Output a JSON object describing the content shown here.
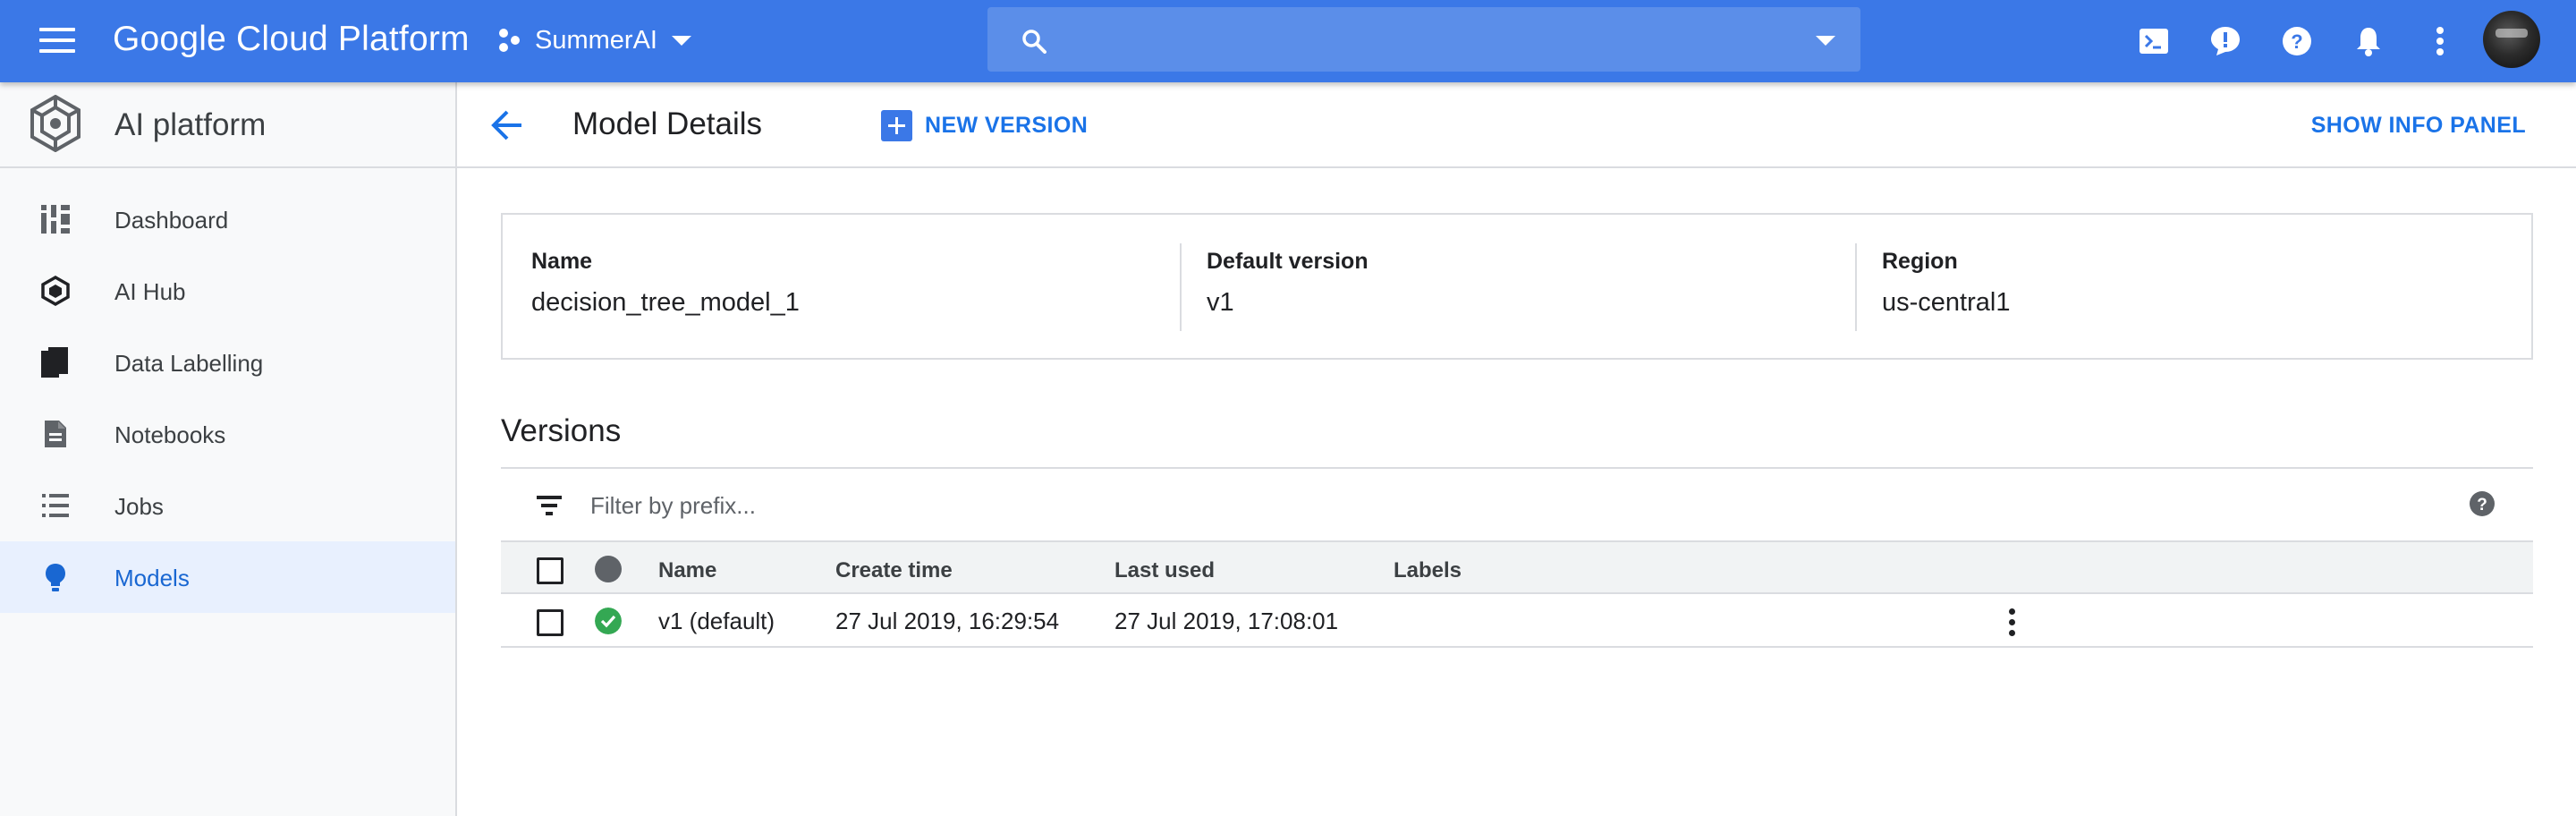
{
  "topbar": {
    "brand": "Google Cloud Platform",
    "project": "SummerAI",
    "search_placeholder": "",
    "bg_color": "#3b78e7",
    "icons": [
      "cloud-shell-icon",
      "feedback-icon",
      "help-icon",
      "notifications-icon",
      "more-vert-icon"
    ]
  },
  "sidebar": {
    "title": "AI platform",
    "items": [
      {
        "label": "Dashboard",
        "icon": "dashboard-icon"
      },
      {
        "label": "AI Hub",
        "icon": "ai-hub-icon"
      },
      {
        "label": "Data Labelling",
        "icon": "data-labelling-icon"
      },
      {
        "label": "Notebooks",
        "icon": "notebooks-icon"
      },
      {
        "label": "Jobs",
        "icon": "jobs-icon"
      },
      {
        "label": "Models",
        "icon": "models-icon",
        "active": true
      }
    ]
  },
  "header": {
    "title": "Model Details",
    "new_version_label": "NEW VERSION",
    "show_info_label": "SHOW INFO PANEL"
  },
  "details": {
    "name_key": "Name",
    "name_value": "decision_tree_model_1",
    "default_version_key": "Default version",
    "default_version_value": "v1",
    "region_key": "Region",
    "region_value": "us-central1"
  },
  "versions": {
    "title": "Versions",
    "filter_placeholder": "Filter by prefix...",
    "columns": [
      "Name",
      "Create time",
      "Last used",
      "Labels"
    ],
    "rows": [
      {
        "name": "v1 (default)",
        "create_time": "27 Jul 2019, 16:29:54",
        "last_used": "27 Jul 2019, 17:08:01",
        "labels": "",
        "status": "ok"
      }
    ],
    "status_ok_color": "#34a853",
    "status_header_color": "#5f6368"
  }
}
